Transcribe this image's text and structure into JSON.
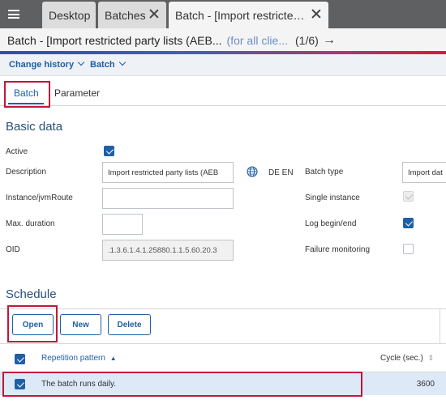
{
  "tabs": [
    {
      "label": "Desktop"
    },
    {
      "label": "Batches"
    },
    {
      "label": "Batch - [Import restricted ..."
    }
  ],
  "titlebar": {
    "title": "Batch - [Import restricted party lists (AEB...",
    "subtitle": "(for all clie...",
    "counter": "(1/6)",
    "next_glyph": "→"
  },
  "actionbar": {
    "change_history": "Change history",
    "batch": "Batch"
  },
  "subtabs": [
    {
      "label": "Batch"
    },
    {
      "label": "Parameter"
    }
  ],
  "basic": {
    "title": "Basic data",
    "active_label": "Active",
    "description_label": "Description",
    "description_value": "Import restricted party lists (AEB",
    "langs": "DE EN",
    "instance_label": "Instance/jvmRoute",
    "instance_value": "",
    "maxdur_label": "Max. duration",
    "maxdur_value": "",
    "oid_label": "OID",
    "oid_value": ".1.3.6.1.4.1.25880.1.1.5.60.20.3",
    "batchtype_label": "Batch type",
    "batchtype_value": "Import dat",
    "single_label": "Single instance",
    "log_label": "Log begin/end",
    "failure_label": "Failure monitoring"
  },
  "schedule": {
    "title": "Schedule",
    "open_label": "Open",
    "new_label": "New",
    "delete_label": "Delete",
    "col_pattern": "Repetition pattern",
    "sort_glyph": "▲",
    "col_cycle": "Cycle (sec.)",
    "sort_both_glyph": "⇕",
    "rows": [
      {
        "pattern": "The batch runs daily.",
        "cycle": "3600"
      }
    ]
  },
  "colors": {
    "accent": "#1d5fa8",
    "highlight": "#c1173c",
    "topbar": "#5f6062"
  }
}
